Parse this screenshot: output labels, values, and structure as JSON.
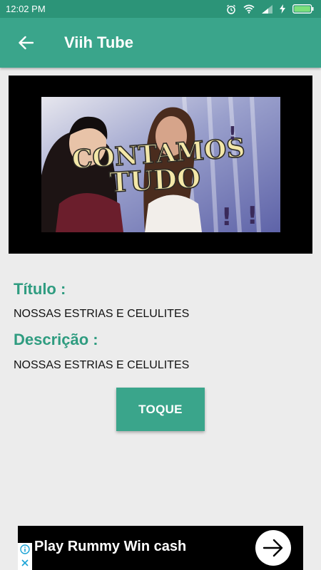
{
  "status_bar": {
    "time": "12:02 PM"
  },
  "app_bar": {
    "title": "Viih Tube"
  },
  "video": {
    "overlay_line1": "CONTAMOS",
    "overlay_line2": "TUDO",
    "overlay_marks": "!"
  },
  "details": {
    "title_label": "Título :",
    "title_value": "NOSSAS ESTRIAS E CELULITES",
    "description_label": "Descrição :",
    "description_value": "NOSSAS ESTRIAS E CELULITES"
  },
  "action": {
    "button_label": "TOQUE"
  },
  "ad": {
    "text": "Play Rummy Win cash"
  },
  "colors": {
    "primary": "#3aa58b",
    "status": "#2c9478",
    "accent_text": "#2f9c80",
    "background": "#ececec"
  }
}
